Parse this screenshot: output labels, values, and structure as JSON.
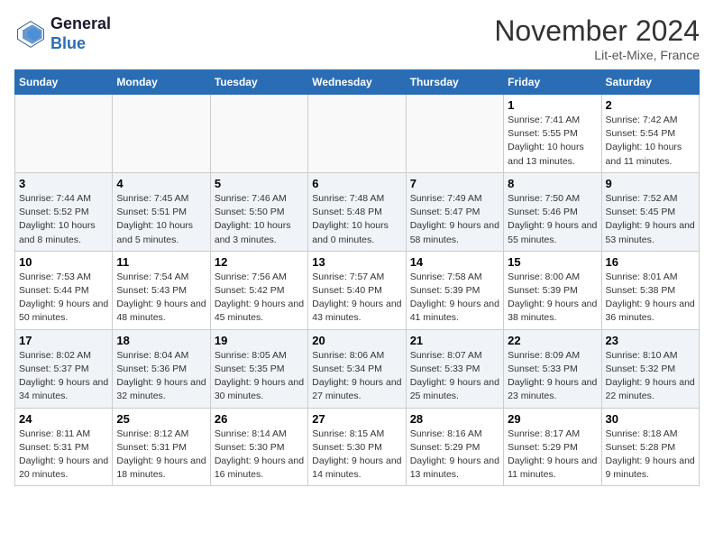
{
  "logo": {
    "line1": "General",
    "line2": "Blue"
  },
  "title": "November 2024",
  "subtitle": "Lit-et-Mixe, France",
  "weekdays": [
    "Sunday",
    "Monday",
    "Tuesday",
    "Wednesday",
    "Thursday",
    "Friday",
    "Saturday"
  ],
  "weeks": [
    [
      {
        "day": "",
        "info": ""
      },
      {
        "day": "",
        "info": ""
      },
      {
        "day": "",
        "info": ""
      },
      {
        "day": "",
        "info": ""
      },
      {
        "day": "",
        "info": ""
      },
      {
        "day": "1",
        "info": "Sunrise: 7:41 AM\nSunset: 5:55 PM\nDaylight: 10 hours and 13 minutes."
      },
      {
        "day": "2",
        "info": "Sunrise: 7:42 AM\nSunset: 5:54 PM\nDaylight: 10 hours and 11 minutes."
      }
    ],
    [
      {
        "day": "3",
        "info": "Sunrise: 7:44 AM\nSunset: 5:52 PM\nDaylight: 10 hours and 8 minutes."
      },
      {
        "day": "4",
        "info": "Sunrise: 7:45 AM\nSunset: 5:51 PM\nDaylight: 10 hours and 5 minutes."
      },
      {
        "day": "5",
        "info": "Sunrise: 7:46 AM\nSunset: 5:50 PM\nDaylight: 10 hours and 3 minutes."
      },
      {
        "day": "6",
        "info": "Sunrise: 7:48 AM\nSunset: 5:48 PM\nDaylight: 10 hours and 0 minutes."
      },
      {
        "day": "7",
        "info": "Sunrise: 7:49 AM\nSunset: 5:47 PM\nDaylight: 9 hours and 58 minutes."
      },
      {
        "day": "8",
        "info": "Sunrise: 7:50 AM\nSunset: 5:46 PM\nDaylight: 9 hours and 55 minutes."
      },
      {
        "day": "9",
        "info": "Sunrise: 7:52 AM\nSunset: 5:45 PM\nDaylight: 9 hours and 53 minutes."
      }
    ],
    [
      {
        "day": "10",
        "info": "Sunrise: 7:53 AM\nSunset: 5:44 PM\nDaylight: 9 hours and 50 minutes."
      },
      {
        "day": "11",
        "info": "Sunrise: 7:54 AM\nSunset: 5:43 PM\nDaylight: 9 hours and 48 minutes."
      },
      {
        "day": "12",
        "info": "Sunrise: 7:56 AM\nSunset: 5:42 PM\nDaylight: 9 hours and 45 minutes."
      },
      {
        "day": "13",
        "info": "Sunrise: 7:57 AM\nSunset: 5:40 PM\nDaylight: 9 hours and 43 minutes."
      },
      {
        "day": "14",
        "info": "Sunrise: 7:58 AM\nSunset: 5:39 PM\nDaylight: 9 hours and 41 minutes."
      },
      {
        "day": "15",
        "info": "Sunrise: 8:00 AM\nSunset: 5:39 PM\nDaylight: 9 hours and 38 minutes."
      },
      {
        "day": "16",
        "info": "Sunrise: 8:01 AM\nSunset: 5:38 PM\nDaylight: 9 hours and 36 minutes."
      }
    ],
    [
      {
        "day": "17",
        "info": "Sunrise: 8:02 AM\nSunset: 5:37 PM\nDaylight: 9 hours and 34 minutes."
      },
      {
        "day": "18",
        "info": "Sunrise: 8:04 AM\nSunset: 5:36 PM\nDaylight: 9 hours and 32 minutes."
      },
      {
        "day": "19",
        "info": "Sunrise: 8:05 AM\nSunset: 5:35 PM\nDaylight: 9 hours and 30 minutes."
      },
      {
        "day": "20",
        "info": "Sunrise: 8:06 AM\nSunset: 5:34 PM\nDaylight: 9 hours and 27 minutes."
      },
      {
        "day": "21",
        "info": "Sunrise: 8:07 AM\nSunset: 5:33 PM\nDaylight: 9 hours and 25 minutes."
      },
      {
        "day": "22",
        "info": "Sunrise: 8:09 AM\nSunset: 5:33 PM\nDaylight: 9 hours and 23 minutes."
      },
      {
        "day": "23",
        "info": "Sunrise: 8:10 AM\nSunset: 5:32 PM\nDaylight: 9 hours and 22 minutes."
      }
    ],
    [
      {
        "day": "24",
        "info": "Sunrise: 8:11 AM\nSunset: 5:31 PM\nDaylight: 9 hours and 20 minutes."
      },
      {
        "day": "25",
        "info": "Sunrise: 8:12 AM\nSunset: 5:31 PM\nDaylight: 9 hours and 18 minutes."
      },
      {
        "day": "26",
        "info": "Sunrise: 8:14 AM\nSunset: 5:30 PM\nDaylight: 9 hours and 16 minutes."
      },
      {
        "day": "27",
        "info": "Sunrise: 8:15 AM\nSunset: 5:30 PM\nDaylight: 9 hours and 14 minutes."
      },
      {
        "day": "28",
        "info": "Sunrise: 8:16 AM\nSunset: 5:29 PM\nDaylight: 9 hours and 13 minutes."
      },
      {
        "day": "29",
        "info": "Sunrise: 8:17 AM\nSunset: 5:29 PM\nDaylight: 9 hours and 11 minutes."
      },
      {
        "day": "30",
        "info": "Sunrise: 8:18 AM\nSunset: 5:28 PM\nDaylight: 9 hours and 9 minutes."
      }
    ]
  ]
}
